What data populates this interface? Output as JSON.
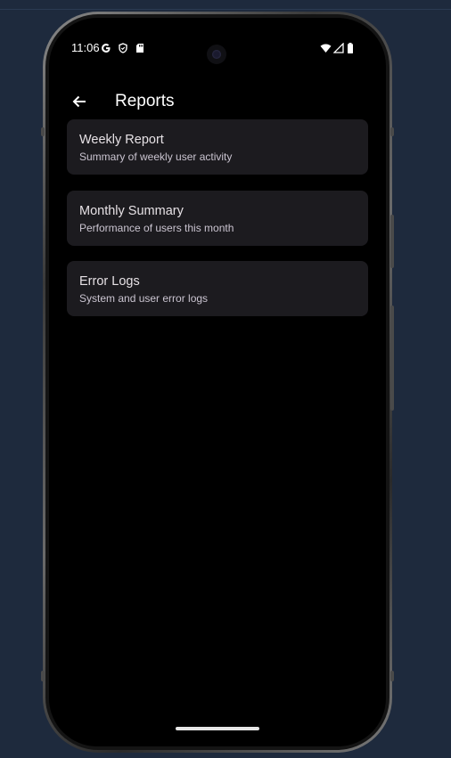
{
  "status_bar": {
    "time": "11:06",
    "icons": [
      "google-g-icon",
      "shield-icon",
      "sd-card-icon",
      "wifi-icon",
      "signal-icon",
      "battery-icon"
    ]
  },
  "app_bar": {
    "back_icon": "arrow-left-icon",
    "title": "Reports"
  },
  "reports": [
    {
      "title": "Weekly Report",
      "subtitle": "Summary of weekly user activity"
    },
    {
      "title": "Monthly Summary",
      "subtitle": "Performance of users this month"
    },
    {
      "title": "Error Logs",
      "subtitle": "System and user error logs"
    }
  ],
  "colors": {
    "page_background": "#1e2a3d",
    "screen_background": "#000000",
    "card_background": "#1c1b1f",
    "title_text": "#ffffff",
    "card_title_text": "#e6e1e5",
    "card_subtitle_text": "#cac4d0"
  }
}
